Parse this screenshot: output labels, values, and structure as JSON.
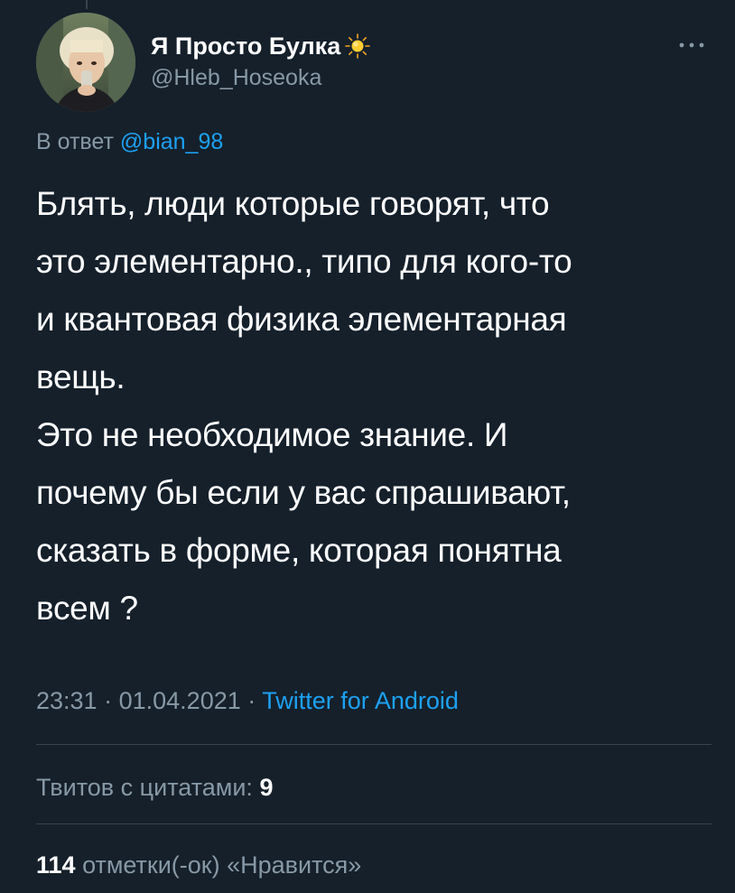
{
  "author": {
    "display_name": "Я Просто Булка",
    "name_emoji": "sun-icon",
    "handle": "@Hleb_Hoseoka"
  },
  "reply": {
    "prefix": "В ответ",
    "mention": "@bian_98"
  },
  "tweet": {
    "lines": [
      "Блять, люди которые говорят, что",
      "это элементарно., типо для кого-то",
      "и квантовая физика элементарная",
      "вещь.",
      "Это не необходимое знание. И",
      "почему бы если у вас спрашивают,",
      "сказать в форме, которая понятна",
      "всем ?"
    ],
    "time": "23:31",
    "separator": "·",
    "date": "01.04.2021",
    "source": "Twitter for Android"
  },
  "stats": {
    "quotes_label": "Твитов с цитатами:",
    "quotes_count": "9",
    "likes_count": "114",
    "likes_label": "отметки(-ок) «Нравится»"
  },
  "colors": {
    "background": "#15202b",
    "text": "#ffffff",
    "secondary": "#8899a6",
    "accent": "#1da1f2",
    "divider": "#38444d"
  }
}
